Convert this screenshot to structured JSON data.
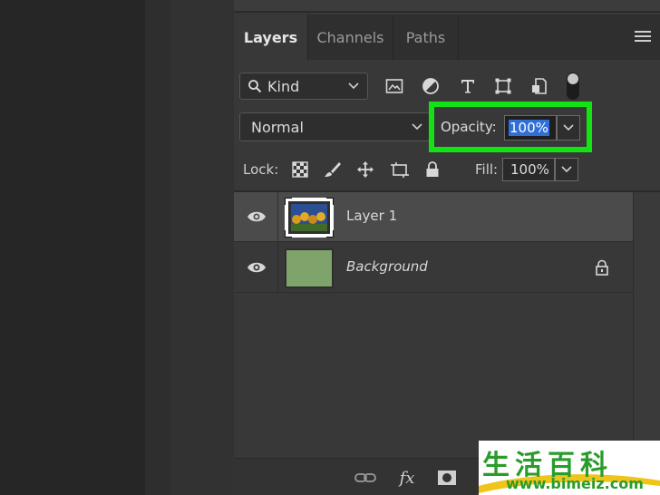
{
  "panel": {
    "tabs": [
      {
        "label": "Layers",
        "active": true
      },
      {
        "label": "Channels",
        "active": false
      },
      {
        "label": "Paths",
        "active": false
      }
    ]
  },
  "filter": {
    "kind_label": "Kind",
    "icons": [
      "image-filter-icon",
      "adjustment-filter-icon",
      "type-filter-icon",
      "shape-filter-icon",
      "smart-object-filter-icon"
    ]
  },
  "blend": {
    "mode": "Normal"
  },
  "opacity": {
    "label": "Opacity:",
    "value": "100%"
  },
  "lock": {
    "label": "Lock:",
    "icons": [
      "lock-transparent-pixels-icon",
      "lock-image-pixels-icon",
      "lock-position-icon",
      "prevent-autonest-icon",
      "lock-all-icon"
    ]
  },
  "fill": {
    "label": "Fill:",
    "value": "100%"
  },
  "layers": [
    {
      "name": "Layer 1",
      "selected": true,
      "locked": false
    },
    {
      "name": "Background",
      "selected": false,
      "locked": true
    }
  ],
  "bottom_bar": {
    "fx_label": "fx"
  },
  "watermark": {
    "chars": "生活百科",
    "url": "www.bimeiz.com"
  },
  "colors": {
    "highlight": "#13e213",
    "selection": "#2f6fd6",
    "panel_bg": "#383838",
    "background_layer_fill": "#7ea36b"
  }
}
